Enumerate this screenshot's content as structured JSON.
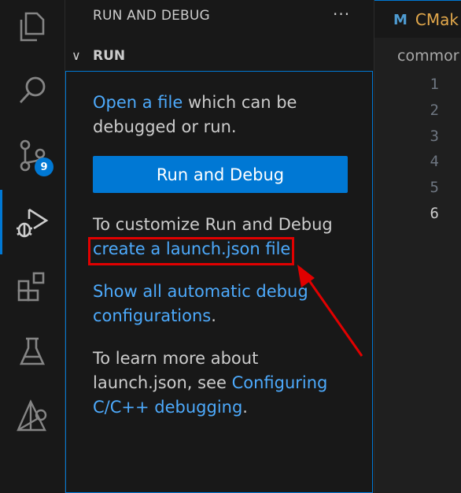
{
  "activity_bar": {
    "items": [
      {
        "name": "explorer-icon"
      },
      {
        "name": "search-icon"
      },
      {
        "name": "source-control-icon",
        "badge": "9"
      },
      {
        "name": "run-debug-icon",
        "active": true
      },
      {
        "name": "extensions-icon"
      },
      {
        "name": "testing-icon"
      },
      {
        "name": "cmake-icon"
      }
    ]
  },
  "sidebar": {
    "title": "RUN AND DEBUG",
    "more": "···",
    "section": "RUN",
    "open_file_link": "Open a file",
    "open_file_rest": " which can be debugged or run.",
    "run_button": "Run and Debug",
    "customize_text": "To customize Run and Debug ",
    "create_link": "create a launch.json file",
    "create_after": ".",
    "show_link": "Show all automatic debug configurations",
    "show_after": ".",
    "learn_before": "To learn more about launch.json, see ",
    "learn_link": "Configuring C/C++ debugging",
    "learn_after": "."
  },
  "editor": {
    "tab_icon": "M",
    "tab_label": "CMak",
    "breadcrumb": "commor",
    "line_numbers": [
      "1",
      "2",
      "3",
      "4",
      "5",
      "6"
    ],
    "current_line": "6"
  },
  "colors": {
    "accent": "#0078d4",
    "link": "#4daafc",
    "annotation": "#e10000"
  }
}
